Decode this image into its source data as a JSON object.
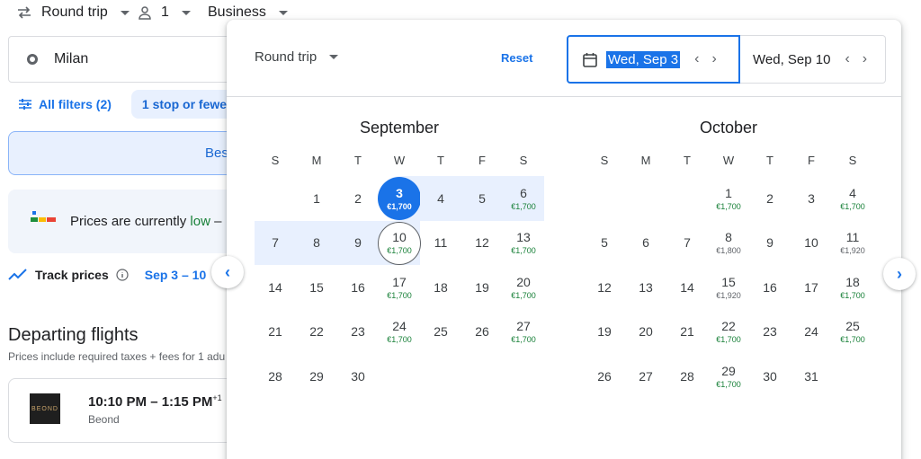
{
  "topbar": {
    "trip_type": "Round trip",
    "passengers": "1",
    "cabin": "Business"
  },
  "search": {
    "origin": "Milan"
  },
  "filters": {
    "all_filters": "All filters (2)",
    "stops_chip": "1 stop or fewer"
  },
  "best_tab": {
    "label": "Bes"
  },
  "insight": {
    "prefix": "Prices are currently",
    "level": "low",
    "suffix": "–"
  },
  "track": {
    "label": "Track prices",
    "dates": "Sep 3 – 10"
  },
  "departing": {
    "title": "Departing flights",
    "subtitle": "Prices include required taxes + fees for 1 adu"
  },
  "flight": {
    "logo_text": "BEOND",
    "time": "10:10 PM – 1:15 PM",
    "day_offset": "+1",
    "airline": "Beond"
  },
  "picker": {
    "trip_type": "Round trip",
    "reset": "Reset",
    "departure": "Wed, Sep 3",
    "return": "Wed, Sep 10",
    "weekdays": [
      "S",
      "M",
      "T",
      "W",
      "T",
      "F",
      "S"
    ],
    "months": [
      {
        "name": "September",
        "offset": 1,
        "days": [
          {
            "d": "1"
          },
          {
            "d": "2"
          },
          {
            "d": "3",
            "p": "€1,700",
            "state": "start"
          },
          {
            "d": "4",
            "state": "range"
          },
          {
            "d": "5",
            "state": "range"
          },
          {
            "d": "6",
            "p": "€1,700",
            "state": "range"
          },
          {
            "d": "7",
            "state": "range"
          },
          {
            "d": "8",
            "state": "range"
          },
          {
            "d": "9",
            "state": "range"
          },
          {
            "d": "10",
            "p": "€1,700",
            "state": "end"
          },
          {
            "d": "11"
          },
          {
            "d": "12"
          },
          {
            "d": "13",
            "p": "€1,700"
          },
          {
            "d": "14"
          },
          {
            "d": "15"
          },
          {
            "d": "16"
          },
          {
            "d": "17",
            "p": "€1,700"
          },
          {
            "d": "18"
          },
          {
            "d": "19"
          },
          {
            "d": "20",
            "p": "€1,700"
          },
          {
            "d": "21"
          },
          {
            "d": "22"
          },
          {
            "d": "23"
          },
          {
            "d": "24",
            "p": "€1,700"
          },
          {
            "d": "25"
          },
          {
            "d": "26"
          },
          {
            "d": "27",
            "p": "€1,700"
          },
          {
            "d": "28"
          },
          {
            "d": "29"
          },
          {
            "d": "30"
          }
        ]
      },
      {
        "name": "October",
        "offset": 3,
        "days": [
          {
            "d": "1",
            "p": "€1,700"
          },
          {
            "d": "2"
          },
          {
            "d": "3"
          },
          {
            "d": "4",
            "p": "€1,700"
          },
          {
            "d": "5"
          },
          {
            "d": "6"
          },
          {
            "d": "7"
          },
          {
            "d": "8",
            "p": "€1,800",
            "neutral": true
          },
          {
            "d": "9"
          },
          {
            "d": "10"
          },
          {
            "d": "11",
            "p": "€1,920",
            "neutral": true
          },
          {
            "d": "12"
          },
          {
            "d": "13"
          },
          {
            "d": "14"
          },
          {
            "d": "15",
            "p": "€1,920",
            "neutral": true
          },
          {
            "d": "16"
          },
          {
            "d": "17"
          },
          {
            "d": "18",
            "p": "€1,700"
          },
          {
            "d": "19"
          },
          {
            "d": "20"
          },
          {
            "d": "21"
          },
          {
            "d": "22",
            "p": "€1,700"
          },
          {
            "d": "23"
          },
          {
            "d": "24"
          },
          {
            "d": "25",
            "p": "€1,700"
          },
          {
            "d": "26"
          },
          {
            "d": "27"
          },
          {
            "d": "28"
          },
          {
            "d": "29",
            "p": "€1,700"
          },
          {
            "d": "30"
          },
          {
            "d": "31"
          }
        ]
      }
    ]
  },
  "colors": {
    "accent": "#1a73e8",
    "range_bg": "#e8f0fe",
    "low_price": "#188038"
  }
}
